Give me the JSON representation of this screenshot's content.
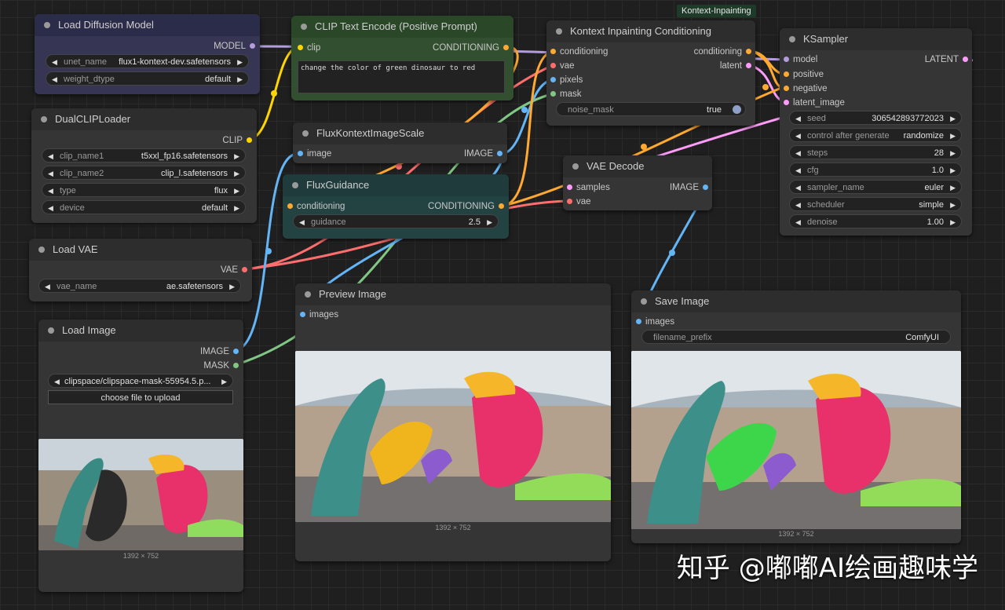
{
  "group_label": "Kontext-Inpainting",
  "watermark": "知乎 @嘟嘟AI绘画趣味学",
  "colors": {
    "clip": "#ffd500",
    "model": "#b39ddb",
    "vae": "#ff6e6e",
    "image": "#64b5f6",
    "mask": "#81c784",
    "conditioning": "#ffa931",
    "latent": "#ff9cf9"
  },
  "nodes": {
    "load_diffusion": {
      "title": "Load Diffusion Model",
      "out": "MODEL",
      "w1_label": "unet_name",
      "w1_value": "flux1-kontext-dev.safetensors",
      "w2_label": "weight_dtype",
      "w2_value": "default"
    },
    "dual_clip": {
      "title": "DualCLIPLoader",
      "out": "CLIP",
      "w1_label": "clip_name1",
      "w1_value": "t5xxl_fp16.safetensors",
      "w2_label": "clip_name2",
      "w2_value": "clip_l.safetensors",
      "w3_label": "type",
      "w3_value": "flux",
      "w4_label": "device",
      "w4_value": "default"
    },
    "load_vae": {
      "title": "Load VAE",
      "out": "VAE",
      "w1_label": "vae_name",
      "w1_value": "ae.safetensors"
    },
    "load_image": {
      "title": "Load Image",
      "out1": "IMAGE",
      "out2": "MASK",
      "file": "clipspace/clipspace-mask-55954.5.p...",
      "upload": "choose file to upload",
      "dims": "1392 × 752"
    },
    "clip_text": {
      "title": "CLIP Text Encode (Positive Prompt)",
      "in": "clip",
      "out": "CONDITIONING",
      "prompt": "change the color of green dinosaur to red"
    },
    "flux_scale": {
      "title": "FluxKontextImageScale",
      "in": "image",
      "out": "IMAGE"
    },
    "flux_guidance": {
      "title": "FluxGuidance",
      "in": "conditioning",
      "out": "CONDITIONING",
      "w1_label": "guidance",
      "w1_value": "2.5"
    },
    "kontext_cond": {
      "title": "Kontext Inpainting Conditioning",
      "in1": "conditioning",
      "in2": "vae",
      "in3": "pixels",
      "in4": "mask",
      "out1": "conditioning",
      "out2": "latent",
      "w1_label": "noise_mask",
      "w1_value": "true"
    },
    "vae_decode": {
      "title": "VAE Decode",
      "in1": "samples",
      "in2": "vae",
      "out": "IMAGE"
    },
    "ksampler": {
      "title": "KSampler",
      "in1": "model",
      "in2": "positive",
      "in3": "negative",
      "in4": "latent_image",
      "out": "LATENT",
      "widgets": [
        {
          "label": "seed",
          "value": "306542893772023"
        },
        {
          "label": "control after generate",
          "value": "randomize"
        },
        {
          "label": "steps",
          "value": "28"
        },
        {
          "label": "cfg",
          "value": "1.0"
        },
        {
          "label": "sampler_name",
          "value": "euler"
        },
        {
          "label": "scheduler",
          "value": "simple"
        },
        {
          "label": "denoise",
          "value": "1.00"
        }
      ]
    },
    "preview": {
      "title": "Preview Image",
      "in": "images",
      "dims": "1392 × 752"
    },
    "save": {
      "title": "Save Image",
      "in": "images",
      "w1_label": "filename_prefix",
      "w1_value": "ComfyUI",
      "dims": "1392 × 752"
    }
  }
}
